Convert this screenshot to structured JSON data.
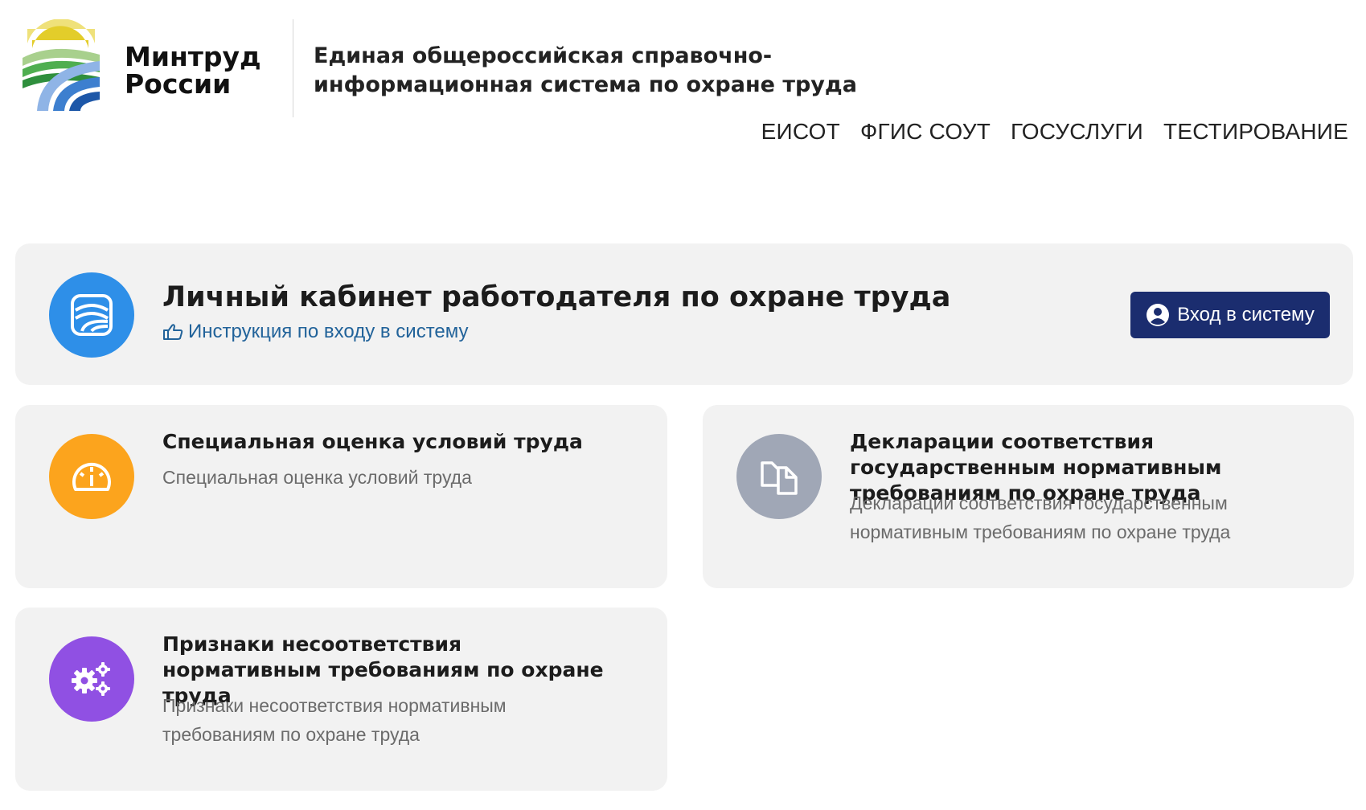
{
  "header": {
    "brand_line1": "Минтруд",
    "brand_line2": "России",
    "system_title": "Единая общероссийская справочно-информационная система по охране труда",
    "nav": [
      "ЕИСОТ",
      "ФГИС СОУТ",
      "ГОСУСЛУГИ",
      "ТЕСТИРОВАНИЕ"
    ]
  },
  "main_card": {
    "title": "Личный кабинет работодателя по охране труда",
    "instruction_link": "Инструкция по входу в систему",
    "login_button": "Вход в систему",
    "icon": "waves-icon",
    "color": "#2e8fe8"
  },
  "cards": [
    {
      "title": "Специальная оценка условий труда",
      "description": "Специальная оценка условий труда",
      "icon": "gauge-icon",
      "color": "#fca41d"
    },
    {
      "title": "Декларации соответствия государственным нормативным требованиям по охране труда",
      "description": "Декларации соответствия государственным нормативным требованиям по охране труда",
      "icon": "documents-icon",
      "color": "#a0a7b6"
    },
    {
      "title": "Признаки несоответствия нормативным требованиям по охране труда",
      "description": "Признаки несоответствия нормативным требованиям по охране труда",
      "icon": "gears-icon",
      "color": "#9050e3"
    }
  ],
  "colors": {
    "login_button": "#1b2d6f",
    "link": "#22639a",
    "card_bg": "#f2f2f2"
  }
}
